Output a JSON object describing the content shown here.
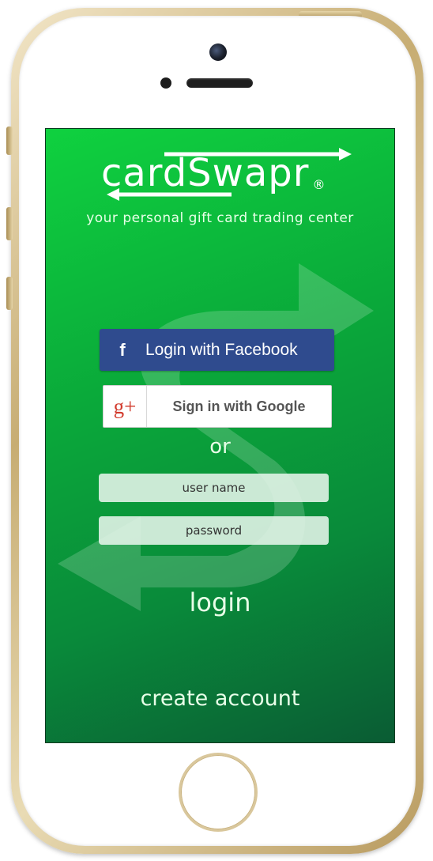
{
  "app": {
    "logo_text": "cardSwapr",
    "registered_mark": "®",
    "tagline": "your personal gift card trading center"
  },
  "social": {
    "facebook_icon": "f",
    "facebook_label": "Login with Facebook",
    "google_icon": "g+",
    "google_label": "Sign in with Google"
  },
  "divider": {
    "or_label": "or"
  },
  "form": {
    "username_placeholder": "user name",
    "password_placeholder": "password",
    "login_label": "login",
    "create_account_label": "create account"
  },
  "colors": {
    "screen_gradient_start": "#0fd13f",
    "screen_gradient_end": "#0a5c34",
    "facebook_blue": "#2f4b8e",
    "google_red": "#d23a2c",
    "phone_gold": "#c7ad73"
  },
  "icons": {
    "facebook": "facebook-icon",
    "google": "google-plus-icon",
    "logo_arrows": "swap-arrows-icon"
  }
}
